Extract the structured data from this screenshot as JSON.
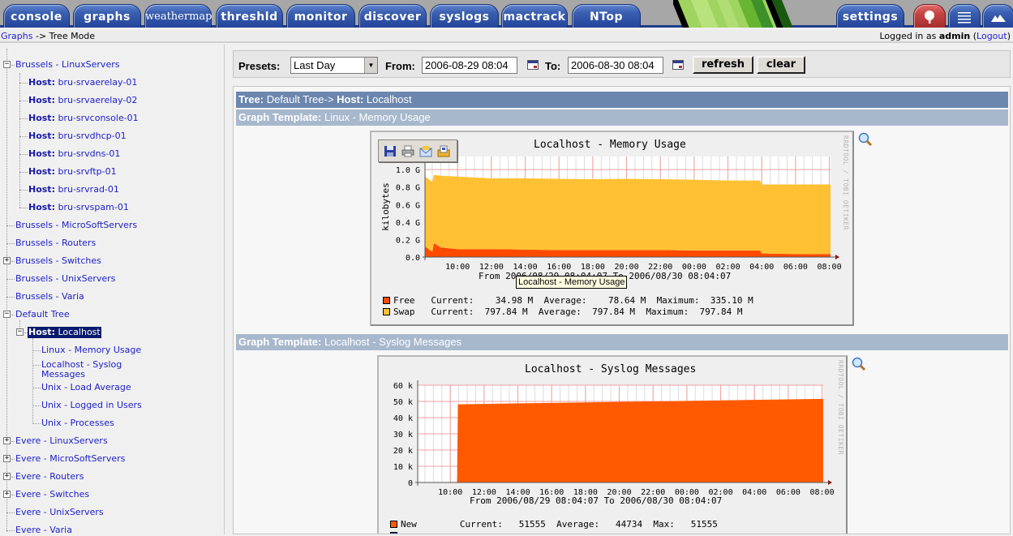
{
  "topnav": {
    "tabs": [
      {
        "label": "console"
      },
      {
        "label": "graphs"
      },
      {
        "label": "weathermap"
      },
      {
        "label": "threshld"
      },
      {
        "label": "monitor"
      },
      {
        "label": "discover"
      },
      {
        "label": "syslogs"
      },
      {
        "label": "mactrack"
      },
      {
        "label": "NTop"
      }
    ],
    "settings_label": "settings",
    "icons": [
      "tree-view-icon",
      "list-view-icon",
      "preview-icon"
    ]
  },
  "breadcrumb": {
    "root": "Graphs",
    "separator": "->",
    "current": "Tree Mode"
  },
  "login": {
    "prefix": "Logged in as",
    "user": "admin",
    "logout": "Logout"
  },
  "tree": {
    "groups": [
      {
        "label": "Brussels - LinuxServers",
        "toggle": "−",
        "hosts": [
          "bru-srvaerelay-01",
          "bru-srvaerelay-02",
          "bru-srvconsole-01",
          "bru-srvdhcp-01",
          "bru-srvdns-01",
          "bru-srvftp-01",
          "bru-srvrad-01",
          "bru-srvspam-01"
        ]
      },
      {
        "label": "Brussels - MicroSoftServers"
      },
      {
        "label": "Brussels - Routers"
      },
      {
        "label": "Brussels - Switches",
        "toggle": "+"
      },
      {
        "label": "Brussels - UnixServers"
      },
      {
        "label": "Brussels - Varia"
      },
      {
        "label": "Default Tree",
        "toggle": "−"
      },
      {
        "label": "Evere - LinuxServers",
        "toggle": "+"
      },
      {
        "label": "Evere - MicroSoftServers",
        "toggle": "+"
      },
      {
        "label": "Evere - Routers",
        "toggle": "+"
      },
      {
        "label": "Evere - Switches",
        "toggle": "+"
      },
      {
        "label": "Evere - UnixServers"
      },
      {
        "label": "Evere - Varia"
      }
    ],
    "host_prefix": "Host:",
    "selected_host": "Localhost",
    "selected_host_graphs": [
      "Linux - Memory Usage",
      "Localhost - Syslog",
      "Messages",
      "Unix - Load Average",
      "Unix - Logged in Users",
      "Unix - Processes"
    ]
  },
  "filter": {
    "presets_label": "Presets:",
    "preset_value": "Last Day",
    "from_label": "From:",
    "from_value": "2006-08-29 08:04",
    "to_label": "To:",
    "to_value": "2006-08-30 08:04",
    "refresh_label": "refresh",
    "clear_label": "clear"
  },
  "content": {
    "tree_header_label": "Tree:",
    "tree_header_value": "Default Tree->",
    "host_header_label": "Host:",
    "host_header_value": "Localhost",
    "template_label": "Graph Template:",
    "templates": [
      "Linux - Memory Usage",
      "Localhost - Syslog Messages"
    ],
    "rrd_credit": "RRDTOOL / TOBI OETIKER",
    "tooltip": "Localhost - Memory Usage"
  },
  "chart_data": [
    {
      "type": "area",
      "title": "Localhost - Memory Usage",
      "ylabel": "kilobytes",
      "xlabel": "",
      "ylim": [
        0,
        1.15
      ],
      "y_unit": "G",
      "yticks": [
        "0.0",
        "0.2 G",
        "0.4 G",
        "0.6 G",
        "0.8 G",
        "1.0 G"
      ],
      "xticks": [
        "10:00",
        "12:00",
        "14:00",
        "16:00",
        "18:00",
        "20:00",
        "22:00",
        "00:00",
        "02:00",
        "04:00",
        "06:00",
        "08:00"
      ],
      "x_hours": [
        8.07,
        8.5,
        8.6,
        9,
        10,
        12,
        14,
        16,
        18,
        20,
        22,
        24,
        26,
        27.9,
        28,
        30,
        32.07
      ],
      "series": [
        {
          "name": "Free",
          "color": "#ff4a00",
          "values": [
            0.12,
            0.06,
            0.16,
            0.11,
            0.09,
            0.09,
            0.085,
            0.08,
            0.08,
            0.08,
            0.08,
            0.075,
            0.075,
            0.075,
            0.04,
            0.035,
            0.035
          ]
        },
        {
          "name": "Swap",
          "color": "#ffc133",
          "values": [
            0.8,
            0.8,
            0.78,
            0.82,
            0.83,
            0.81,
            0.815,
            0.815,
            0.81,
            0.815,
            0.81,
            0.81,
            0.8,
            0.8,
            0.79,
            0.795,
            0.795
          ]
        }
      ],
      "subtitle": "From 2006/08/29 08:04:07 To 2006/08/30 08:04:07",
      "legend": [
        {
          "name": "Free",
          "color": "#ff4a00",
          "current": "34.98 M",
          "average": "78.64 M",
          "maximum": "335.10 M"
        },
        {
          "name": "Swap",
          "color": "#ffc133",
          "current": "797.84 M",
          "average": "797.84 M",
          "maximum": "797.84 M"
        }
      ],
      "legend_labels": {
        "current": "Current:",
        "average": "Average:",
        "maximum": "Maximum:"
      },
      "grid": true
    },
    {
      "type": "area",
      "title": "Localhost - Syslog Messages",
      "ylabel": "",
      "xlabel": "",
      "ylim": [
        0,
        60000
      ],
      "yticks": [
        "0",
        "10 k",
        "20 k",
        "30 k",
        "40 k",
        "50 k",
        "60 k"
      ],
      "xticks": [
        "10:00",
        "12:00",
        "14:00",
        "16:00",
        "18:00",
        "20:00",
        "22:00",
        "00:00",
        "02:00",
        "04:00",
        "06:00",
        "08:00"
      ],
      "x_hours": [
        8.07,
        10.4,
        10.45,
        32.07
      ],
      "series": [
        {
          "name": "New",
          "color": "#ff5a00",
          "values": [
            0,
            300,
            48200,
            51555
          ]
        }
      ],
      "subtitle": "From 2006/08/29 08:04:07 To 2006/08/30 08:04:07",
      "legend": [
        {
          "name": "New",
          "color": "#ff5a00",
          "current": "51555",
          "average": "44734",
          "maximum": "51555"
        }
      ],
      "legend_labels": {
        "current": "Current:",
        "average": "Average:",
        "maximum": "Max:"
      },
      "grid": true
    }
  ]
}
